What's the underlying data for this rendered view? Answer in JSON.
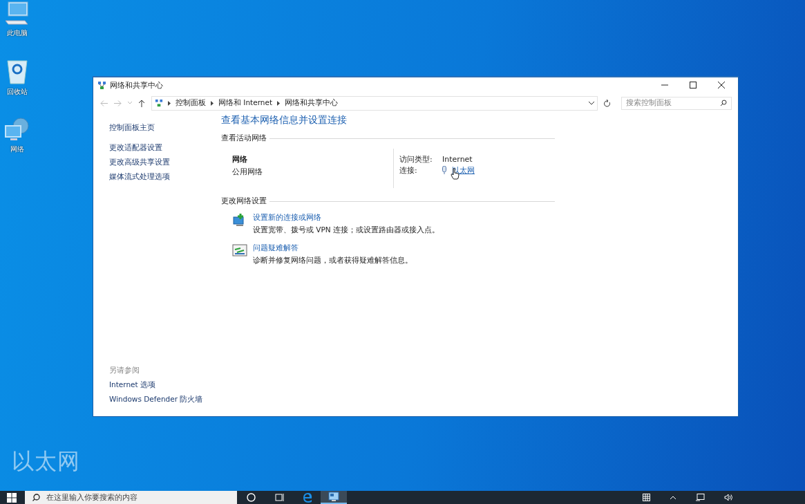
{
  "desktop_icons": [
    {
      "label": "此电脑",
      "kind": "computer"
    },
    {
      "label": "回收站",
      "kind": "recycle"
    },
    {
      "label": "网络",
      "kind": "network"
    }
  ],
  "window": {
    "title": "网络和共享中心"
  },
  "address_bar": {
    "breadcrumbs": [
      "控制面板",
      "网络和 Internet",
      "网络和共享中心"
    ]
  },
  "search": {
    "placeholder": "搜索控制面板"
  },
  "sidebar": {
    "items": [
      "控制面板主页",
      "更改适配器设置",
      "更改高级共享设置",
      "媒体流式处理选项"
    ],
    "see_also": {
      "heading": "另请参阅",
      "items": [
        "Internet 选项",
        "Windows Defender 防火墙"
      ]
    }
  },
  "main": {
    "heading": "查看基本网络信息并设置连接",
    "active_networks": {
      "heading": "查看活动网络",
      "name": "网络",
      "type": "公用网络",
      "access_label": "访问类型:",
      "access_value": "Internet",
      "connection_label": "连接:",
      "connection_value": "以太网"
    },
    "change_settings": {
      "heading": "更改网络设置",
      "tasks": [
        {
          "kind": "new_connection",
          "title": "设置新的连接或网络",
          "description": "设置宽带、拨号或 VPN 连接；或设置路由器或接入点。"
        },
        {
          "kind": "troubleshoot",
          "title": "问题疑难解答",
          "description": "诊断并修复网络问题，或者获得疑难解答信息。"
        }
      ]
    }
  },
  "caption": "以太网",
  "taskbar": {
    "search_placeholder": "在这里输入你要搜索的内容",
    "apps": [
      {
        "kind": "edge",
        "selected": false
      },
      {
        "kind": "control_panel",
        "selected": true
      }
    ]
  }
}
